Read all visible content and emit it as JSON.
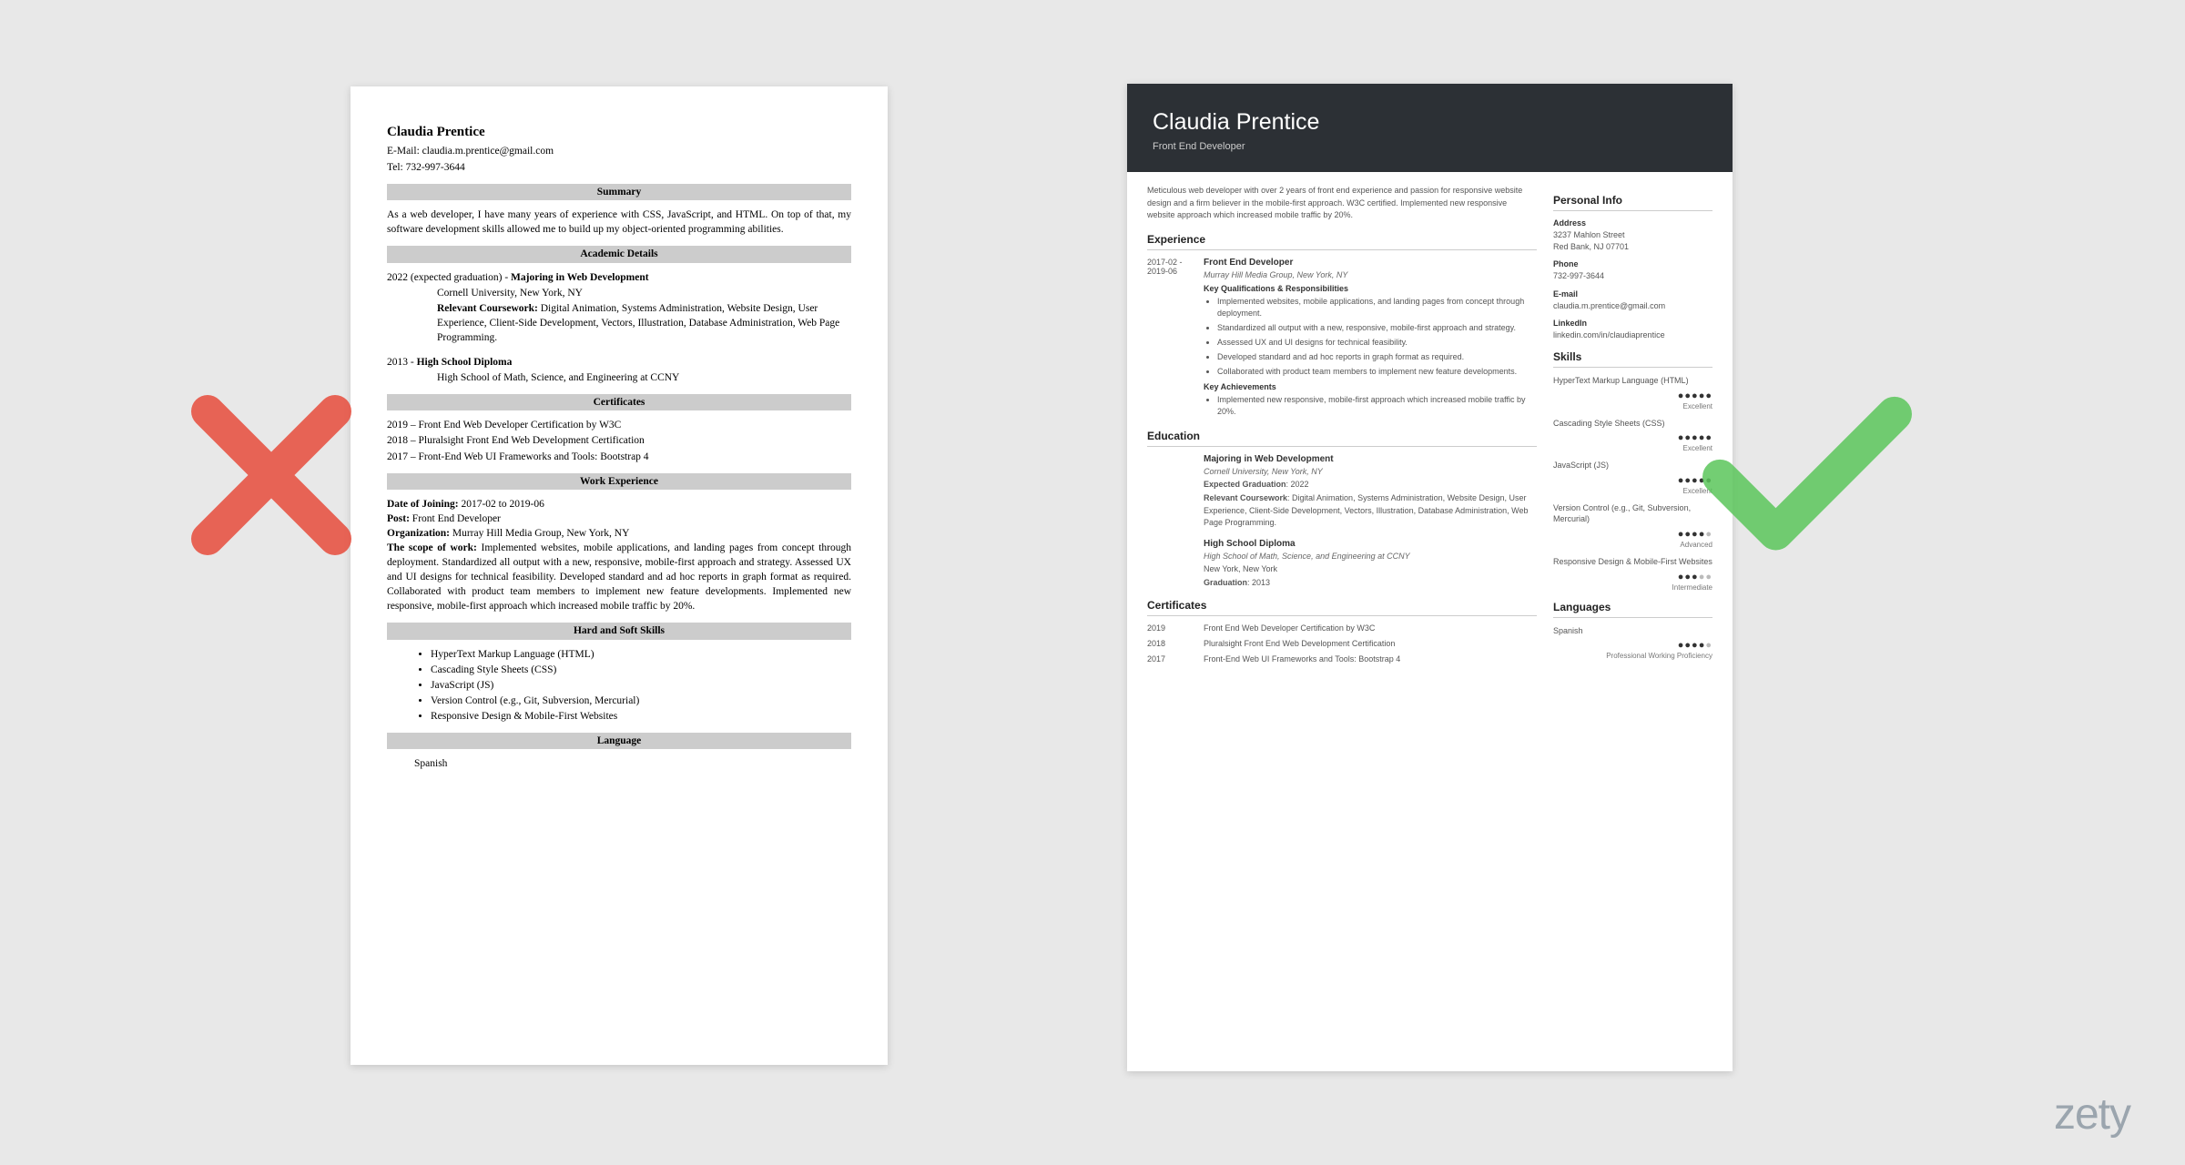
{
  "brand": "zety",
  "left": {
    "name": "Claudia Prentice",
    "email_label": "E-Mail:",
    "email": "claudia.m.prentice@gmail.com",
    "tel_label": "Tel:",
    "tel": "732-997-3644",
    "h_summary": "Summary",
    "summary": "As a web developer, I have many years of experience with CSS, JavaScript, and HTML. On top of that, my software development skills allowed me to build up my object-oriented programming abilities.",
    "h_academic": "Academic Details",
    "edu1_year": "2022 (expected graduation) - ",
    "edu1_deg": "Majoring in Web Development",
    "edu1_school": "Cornell University, New York, NY",
    "edu1_course_label": "Relevant Coursework:",
    "edu1_course": " Digital Animation, Systems Administration, Website Design, User Experience, Client-Side Development, Vectors, Illustration, Database Administration, Web Page Programming.",
    "edu2_year": "2013 - ",
    "edu2_deg": "High School Diploma",
    "edu2_school": "High School of Math, Science, and Engineering at CCNY",
    "h_certs": "Certificates",
    "cert1": "2019 – Front End Web Developer Certification by W3C",
    "cert2": "2018 – Pluralsight Front End Web Development Certification",
    "cert3": "2017 – Front-End Web UI Frameworks and Tools: Bootstrap 4",
    "h_work": "Work Experience",
    "w_date_label": "Date of Joining:",
    "w_date": " 2017-02 to 2019-06",
    "w_post_label": "Post:",
    "w_post": " Front End Developer",
    "w_org_label": "Organization:",
    "w_org": " Murray Hill Media Group, New York, NY",
    "w_scope_label": "The scope of work:",
    "w_scope": " Implemented websites, mobile applications, and landing pages from concept through deployment. Standardized all output with a new, responsive, mobile-first approach and strategy. Assessed UX and UI designs for technical feasibility. Developed standard and ad hoc reports in graph format as required. Collaborated with product team members to implement new feature developments. Implemented new responsive, mobile-first approach which increased mobile traffic by 20%.",
    "h_skills": "Hard and Soft Skills",
    "skills": [
      "HyperText Markup Language (HTML)",
      "Cascading Style Sheets (CSS)",
      "JavaScript (JS)",
      "Version Control (e.g., Git, Subversion, Mercurial)",
      "Responsive Design & Mobile-First Websites"
    ],
    "h_lang": "Language",
    "lang": "Spanish"
  },
  "right": {
    "name": "Claudia Prentice",
    "title": "Front End Developer",
    "summary": "Meticulous web developer with over 2 years of front end experience and passion for responsive website design and a firm believer in the mobile-first approach. W3C certified. Implemented new responsive website approach which increased mobile traffic by 20%.",
    "h_exp": "Experience",
    "exp_date": "2017-02 - 2019-06",
    "exp_title": "Front End Developer",
    "exp_org": "Murray Hill Media Group, New York, NY",
    "exp_qual_h": "Key Qualifications & Responsibilities",
    "exp_bullets": [
      "Implemented websites, mobile applications, and landing pages from concept through deployment.",
      "Standardized all output with a new, responsive, mobile-first approach and strategy.",
      "Assessed UX and UI designs for technical feasibility.",
      "Developed standard and ad hoc reports in graph format as required.",
      "Collaborated with product team members to implement new feature developments."
    ],
    "exp_ach_h": "Key Achievements",
    "exp_ach": [
      "Implemented new responsive, mobile-first approach which increased mobile traffic by 20%."
    ],
    "h_edu": "Education",
    "edu": [
      {
        "deg": "Majoring in Web Development",
        "sch": "Cornell University, New York, NY",
        "grad_label": "Expected Graduation",
        "grad": ": 2022",
        "course_label": "Relevant Coursework",
        "course": ": Digital Animation, Systems Administration, Website Design, User Experience, Client-Side Development, Vectors, Illustration, Database Administration, Web Page Programming."
      },
      {
        "deg": "High School Diploma",
        "sch": "High School of Math, Science, and Engineering at CCNY",
        "loc": "New York, New York",
        "grad_label": "Graduation",
        "grad": ": 2013"
      }
    ],
    "h_certs": "Certificates",
    "certs": [
      {
        "yr": "2019",
        "txt": "Front End Web Developer Certification by W3C"
      },
      {
        "yr": "2018",
        "txt": "Pluralsight Front End Web Development Certification"
      },
      {
        "yr": "2017",
        "txt": "Front-End Web UI Frameworks and Tools: Bootstrap 4"
      }
    ],
    "h_info": "Personal Info",
    "info": {
      "addr_l": "Address",
      "addr": "3237 Mahlon Street\nRed Bank, NJ 07701",
      "phone_l": "Phone",
      "phone": "732-997-3644",
      "email_l": "E-mail",
      "email": "claudia.m.prentice@gmail.com",
      "li_l": "LinkedIn",
      "li": "linkedin.com/in/claudiaprentice"
    },
    "h_skills": "Skills",
    "skills": [
      {
        "name": "HyperText Markup Language (HTML)",
        "dots": 5,
        "label": "Excellent"
      },
      {
        "name": "Cascading Style Sheets (CSS)",
        "dots": 5,
        "label": "Excellent"
      },
      {
        "name": "JavaScript (JS)",
        "dots": 5,
        "label": "Excellent"
      },
      {
        "name": "Version Control (e.g., Git, Subversion, Mercurial)",
        "dots": 4,
        "label": "Advanced"
      },
      {
        "name": "Responsive Design & Mobile-First Websites",
        "dots": 3,
        "label": "Intermediate"
      }
    ],
    "h_lang": "Languages",
    "langs": [
      {
        "name": "Spanish",
        "dots": 4,
        "label": "Professional Working Proficiency"
      }
    ]
  }
}
